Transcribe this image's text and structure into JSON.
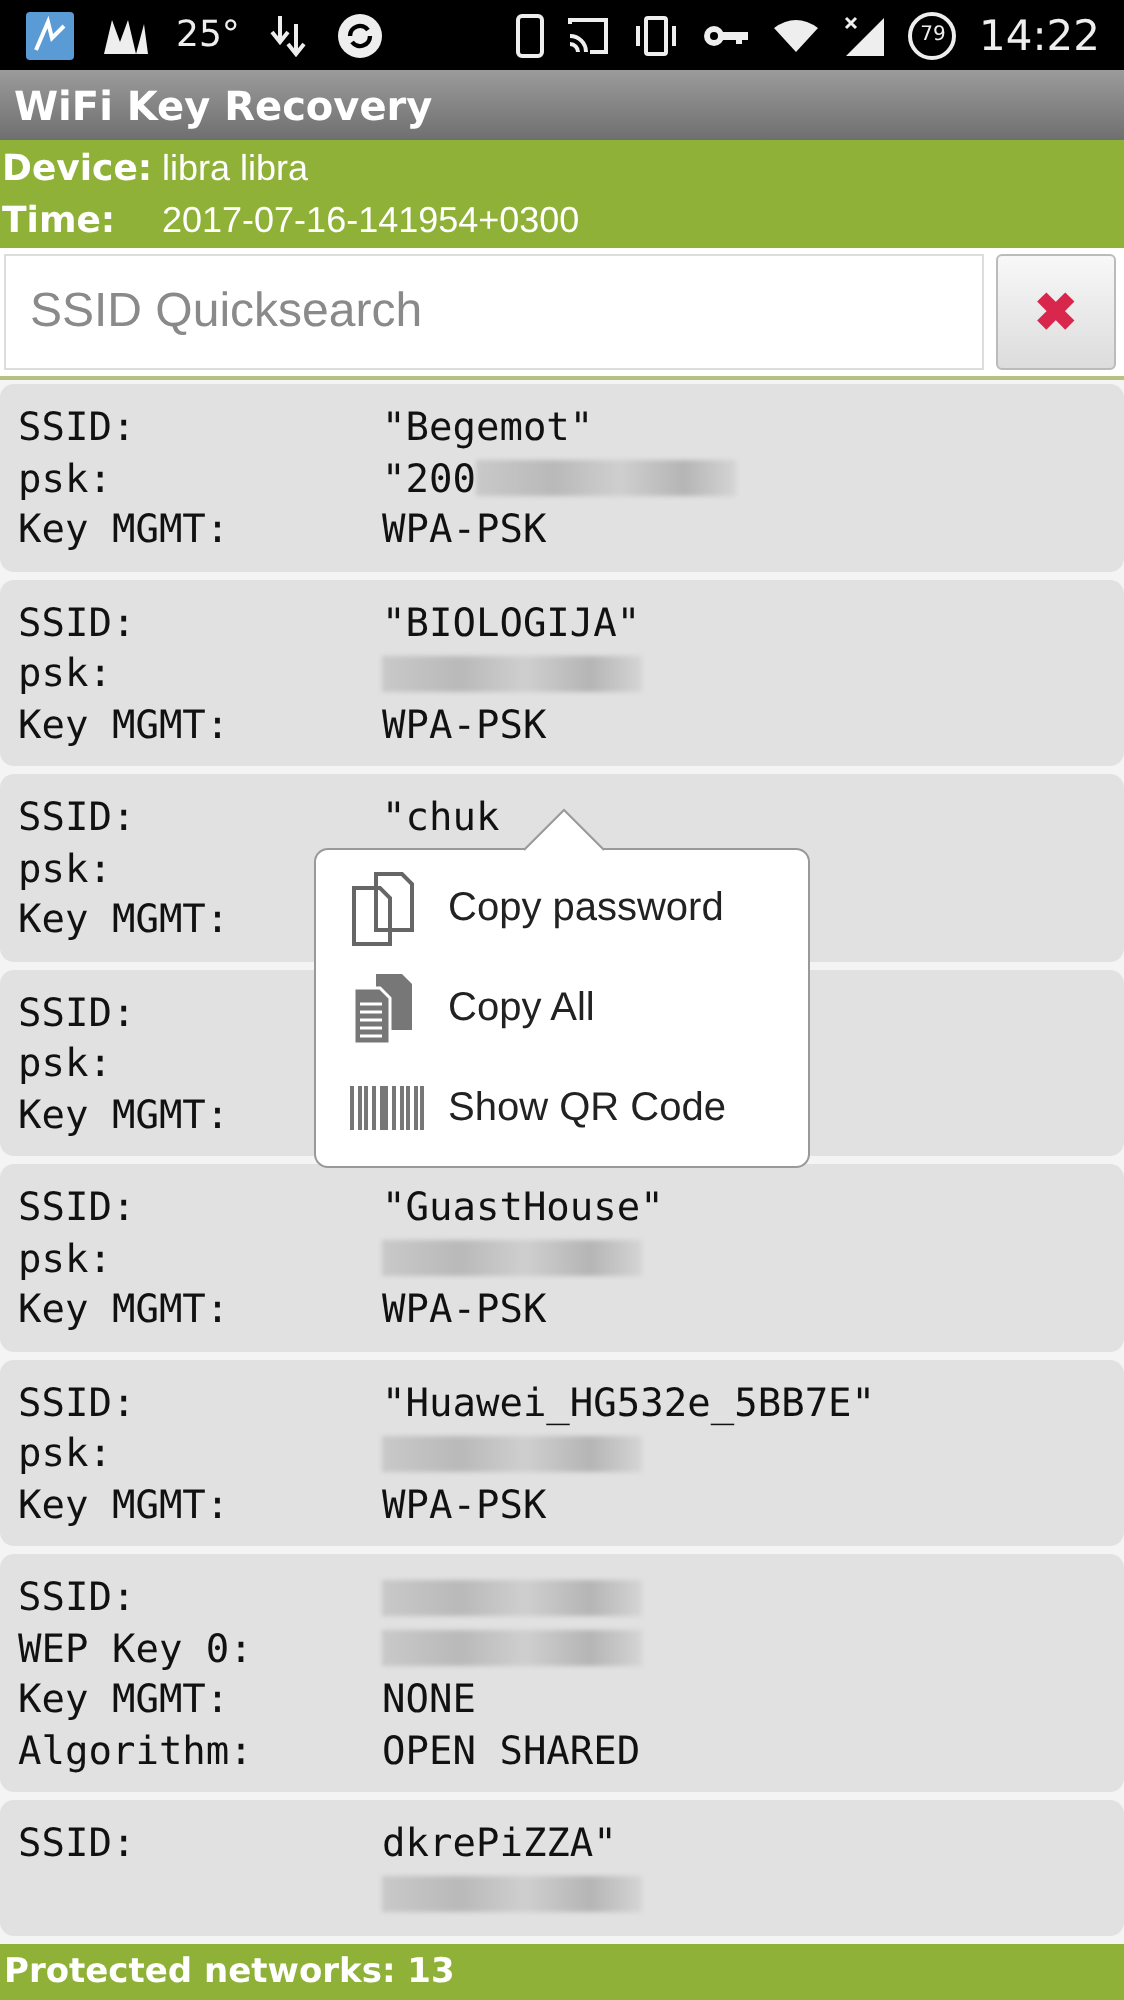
{
  "status_bar": {
    "temperature": "25°",
    "battery": "79",
    "time": "14:22"
  },
  "window": {
    "title": "WiFi Key Recovery"
  },
  "info": [
    {
      "label": "Device:",
      "value": "libra libra"
    },
    {
      "label": "Time:",
      "value": "2017-07-16-141954+0300"
    }
  ],
  "search": {
    "placeholder": "SSID Quicksearch",
    "clear_icon": "✖"
  },
  "networks": [
    {
      "fields": [
        {
          "label": "SSID:",
          "value": "\"Begemot\""
        },
        {
          "label": "psk:",
          "value": "\"200",
          "redacted": true
        },
        {
          "label": "Key MGMT:",
          "value": "WPA-PSK"
        }
      ]
    },
    {
      "fields": [
        {
          "label": "SSID:",
          "value": "\"BIOLOGIJA\""
        },
        {
          "label": "psk:",
          "redacted": true
        },
        {
          "label": "Key MGMT:",
          "value": "WPA-PSK"
        }
      ]
    },
    {
      "fields": [
        {
          "label": "SSID:",
          "value": "\"chuk"
        },
        {
          "label": "psk:"
        },
        {
          "label": "Key MGMT:"
        }
      ]
    },
    {
      "fields": [
        {
          "label": "SSID:"
        },
        {
          "label": "psk:"
        },
        {
          "label": "Key MGMT:"
        }
      ]
    },
    {
      "fields": [
        {
          "label": "SSID:",
          "value": "\"GuastHouse\""
        },
        {
          "label": "psk:",
          "redacted": true
        },
        {
          "label": "Key MGMT:",
          "value": "WPA-PSK"
        }
      ]
    },
    {
      "fields": [
        {
          "label": "SSID:",
          "value": "\"Huawei_HG532e_5BB7E\""
        },
        {
          "label": "psk:",
          "redacted": true
        },
        {
          "label": "Key MGMT:",
          "value": "WPA-PSK"
        }
      ]
    },
    {
      "fields": [
        {
          "label": "SSID:",
          "redacted": true
        },
        {
          "label": "WEP Key 0:",
          "redacted": true
        },
        {
          "label": "Key MGMT:",
          "value": "NONE"
        },
        {
          "label": "Algorithm:",
          "value": "OPEN SHARED"
        }
      ]
    },
    {
      "fields": [
        {
          "label": "SSID:",
          "value": "dkrePiZZA\""
        },
        {
          "redacted": true
        }
      ]
    }
  ],
  "context_menu": {
    "items": [
      {
        "kind": "copy",
        "label": "Copy password"
      },
      {
        "kind": "copy_all",
        "label": "Copy All"
      },
      {
        "kind": "qr",
        "label": "Show QR Code"
      }
    ]
  },
  "footer": {
    "text": "Protected networks: 13"
  }
}
